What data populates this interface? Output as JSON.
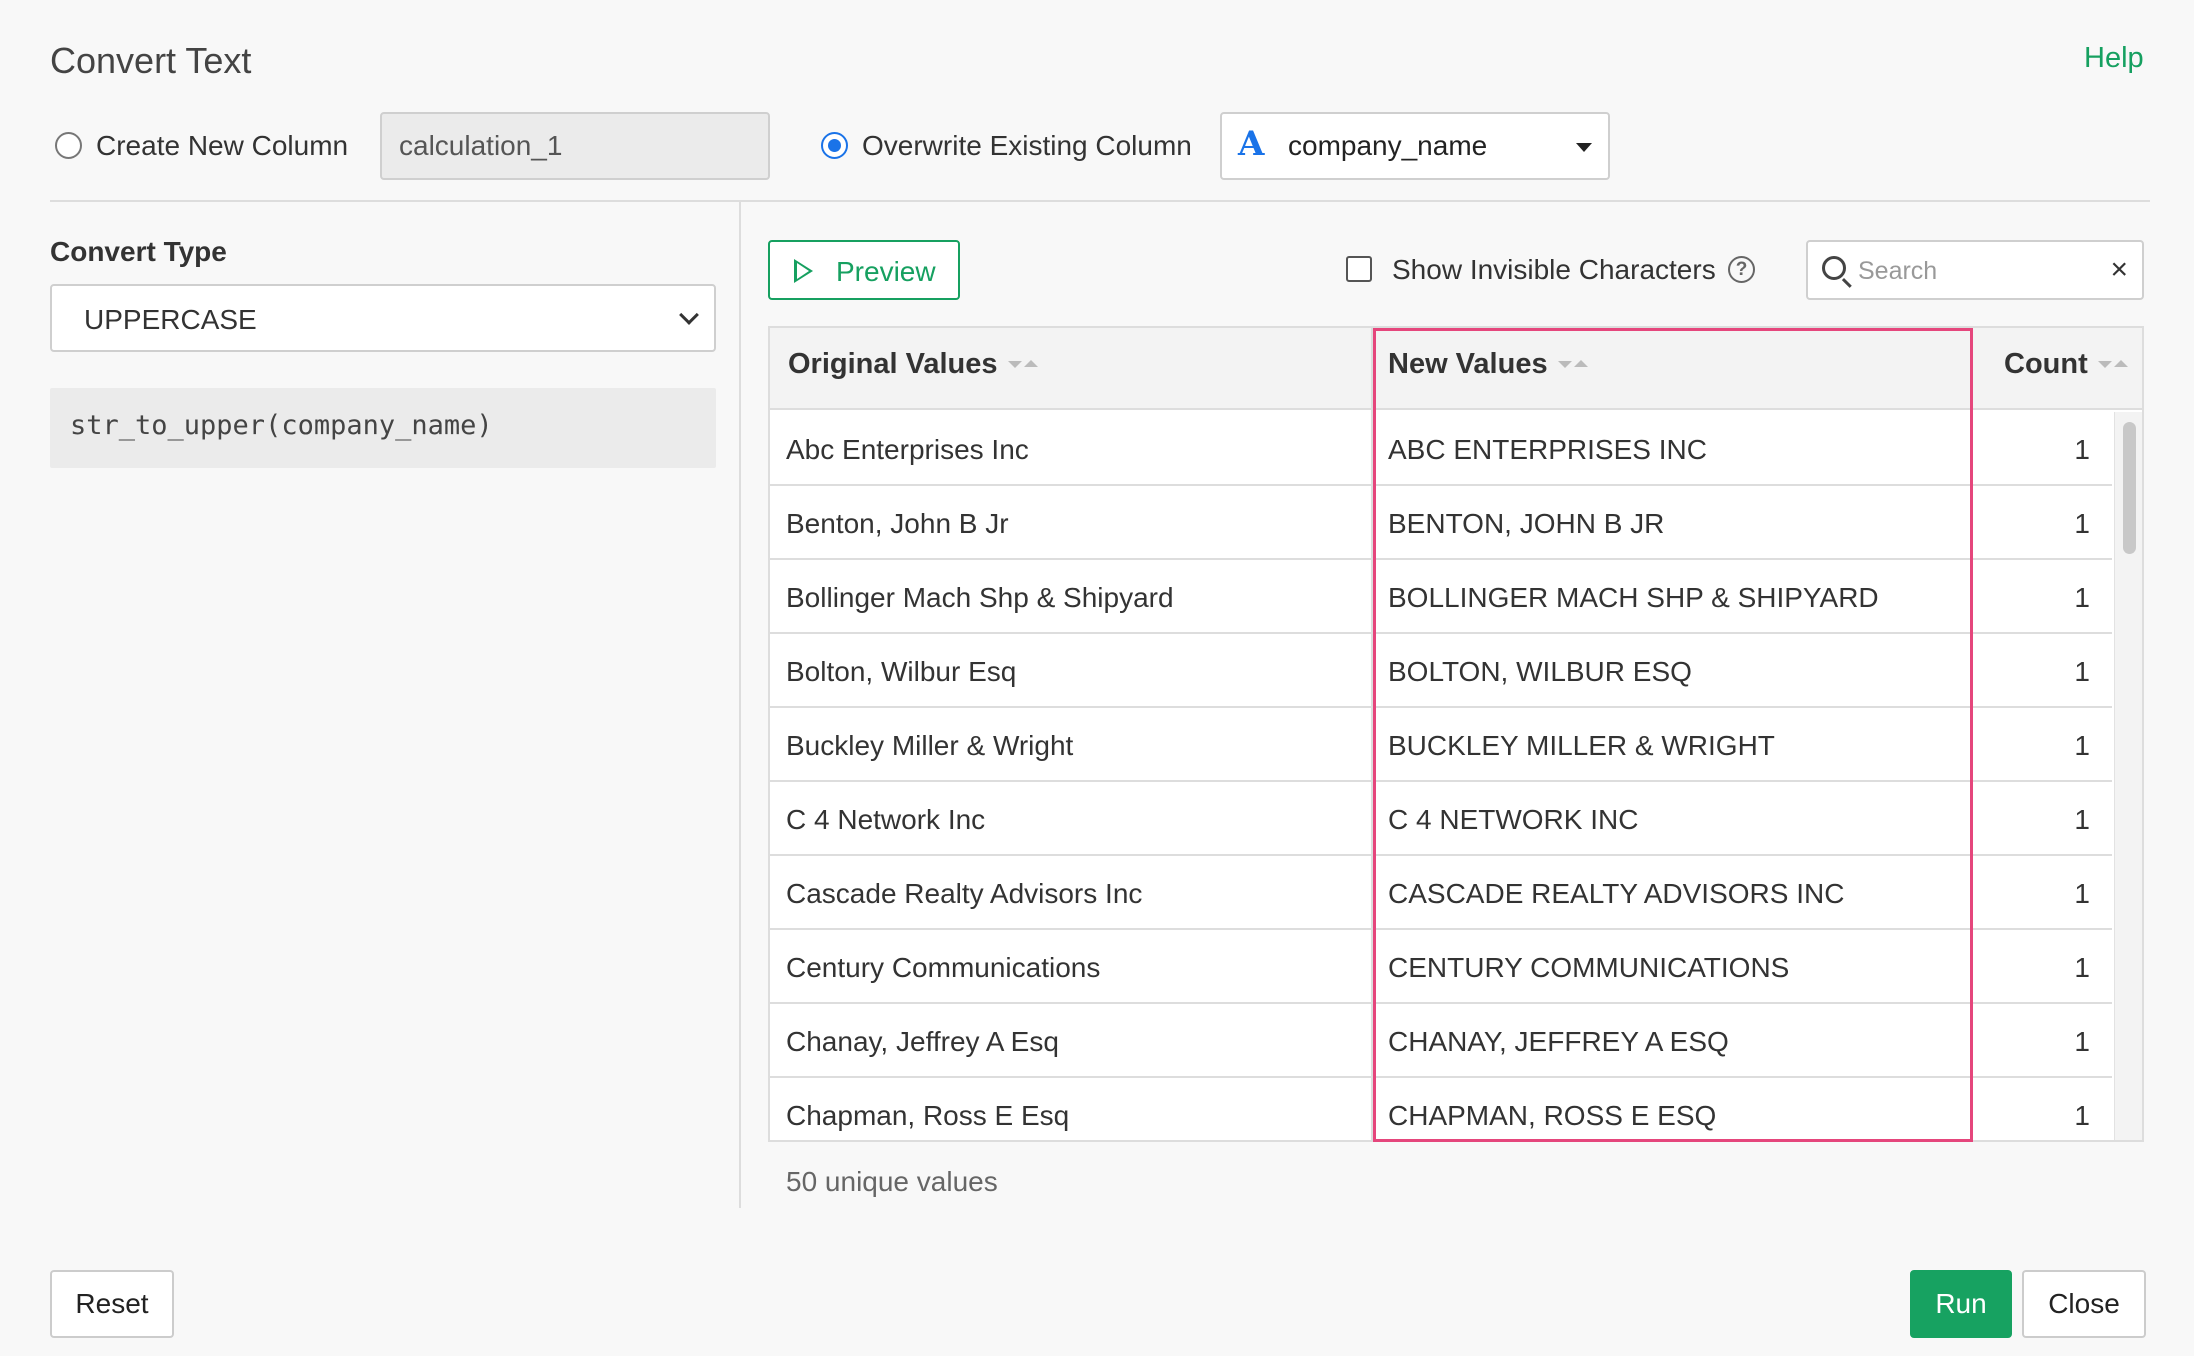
{
  "dialog": {
    "title": "Convert Text",
    "help_label": "Help"
  },
  "output": {
    "create_new_label": "Create New Column",
    "create_new_selected": false,
    "new_column_value": "calculation_1",
    "overwrite_label": "Overwrite Existing Column",
    "overwrite_selected": true,
    "column_type_glyph": "A",
    "column_type_icon": "text-type-icon",
    "selected_column": "company_name"
  },
  "convert": {
    "label": "Convert Type",
    "selected_type": "UPPERCASE",
    "expression": "str_to_upper(company_name)"
  },
  "toolbar": {
    "preview_label": "Preview",
    "show_invisible_label": "Show Invisible Characters",
    "show_invisible_checked": false,
    "help_glyph": "?",
    "search_placeholder": "Search",
    "clear_glyph": "×"
  },
  "table": {
    "headers": {
      "original": "Original Values",
      "new": "New Values",
      "count": "Count"
    },
    "rows": [
      {
        "original": "Abc Enterprises Inc",
        "new": "ABC ENTERPRISES INC",
        "count": "1"
      },
      {
        "original": "Benton, John B Jr",
        "new": "BENTON, JOHN B JR",
        "count": "1"
      },
      {
        "original": "Bollinger Mach Shp & Shipyard",
        "new": "BOLLINGER MACH SHP & SHIPYARD",
        "count": "1"
      },
      {
        "original": "Bolton, Wilbur Esq",
        "new": "BOLTON, WILBUR ESQ",
        "count": "1"
      },
      {
        "original": "Buckley Miller & Wright",
        "new": "BUCKLEY MILLER & WRIGHT",
        "count": "1"
      },
      {
        "original": "C 4 Network Inc",
        "new": "C 4 NETWORK INC",
        "count": "1"
      },
      {
        "original": "Cascade Realty Advisors Inc",
        "new": "CASCADE REALTY ADVISORS INC",
        "count": "1"
      },
      {
        "original": "Century Communications",
        "new": "CENTURY COMMUNICATIONS",
        "count": "1"
      },
      {
        "original": "Chanay, Jeffrey A Esq",
        "new": "CHANAY, JEFFREY A ESQ",
        "count": "1"
      },
      {
        "original": "Chapman, Ross E Esq",
        "new": "CHAPMAN, ROSS E ESQ",
        "count": "1"
      }
    ],
    "footer_text": "50 unique values"
  },
  "footer": {
    "reset_label": "Reset",
    "run_label": "Run",
    "close_label": "Close"
  },
  "colors": {
    "accent_green": "#16a060",
    "radio_blue": "#1a73e8",
    "highlight_pink": "#e5467c"
  }
}
